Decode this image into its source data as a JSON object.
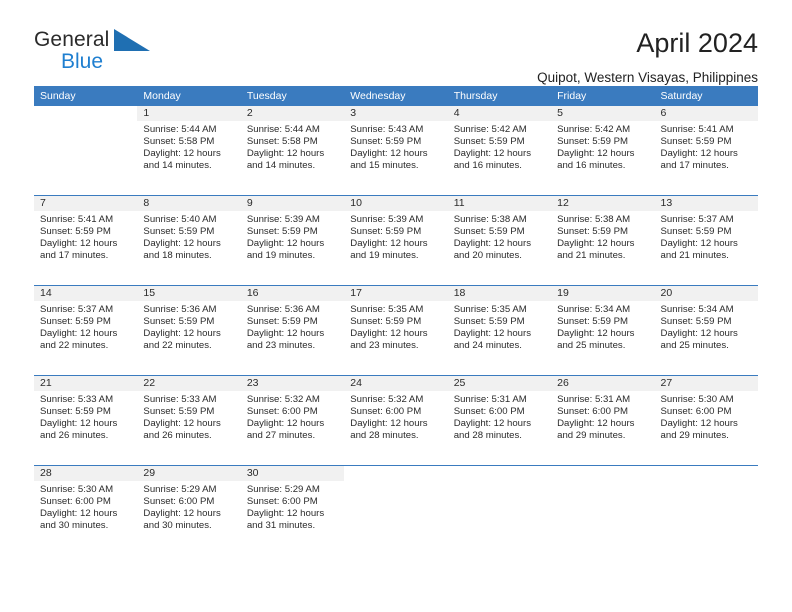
{
  "brand": {
    "name_top": "General",
    "name_bottom": "Blue",
    "triangle_icon": "blue-triangle-logo-mark",
    "color_blue": "#1f7fd0",
    "color_dark": "#2b2b2b"
  },
  "header": {
    "title": "April 2024",
    "subtitle": "Quipot, Western Visayas, Philippines"
  },
  "theme": {
    "header_bar": "#3a7bbf",
    "day_band": "#f1f1f1",
    "text": "#2b2b2b"
  },
  "calendar": {
    "weekday_headers": [
      "Sunday",
      "Monday",
      "Tuesday",
      "Wednesday",
      "Thursday",
      "Friday",
      "Saturday"
    ],
    "labels": {
      "sunrise_prefix": "Sunrise:",
      "sunset_prefix": "Sunset:",
      "daylight_prefix": "Daylight:"
    },
    "weeks": [
      [
        {
          "day": "",
          "blank": true,
          "lines": []
        },
        {
          "day": "1",
          "lines": [
            "Sunrise: 5:44 AM",
            "Sunset: 5:58 PM",
            "Daylight: 12 hours",
            "and 14 minutes."
          ]
        },
        {
          "day": "2",
          "lines": [
            "Sunrise: 5:44 AM",
            "Sunset: 5:58 PM",
            "Daylight: 12 hours",
            "and 14 minutes."
          ]
        },
        {
          "day": "3",
          "lines": [
            "Sunrise: 5:43 AM",
            "Sunset: 5:59 PM",
            "Daylight: 12 hours",
            "and 15 minutes."
          ]
        },
        {
          "day": "4",
          "lines": [
            "Sunrise: 5:42 AM",
            "Sunset: 5:59 PM",
            "Daylight: 12 hours",
            "and 16 minutes."
          ]
        },
        {
          "day": "5",
          "lines": [
            "Sunrise: 5:42 AM",
            "Sunset: 5:59 PM",
            "Daylight: 12 hours",
            "and 16 minutes."
          ]
        },
        {
          "day": "6",
          "lines": [
            "Sunrise: 5:41 AM",
            "Sunset: 5:59 PM",
            "Daylight: 12 hours",
            "and 17 minutes."
          ]
        }
      ],
      [
        {
          "day": "7",
          "lines": [
            "Sunrise: 5:41 AM",
            "Sunset: 5:59 PM",
            "Daylight: 12 hours",
            "and 17 minutes."
          ]
        },
        {
          "day": "8",
          "lines": [
            "Sunrise: 5:40 AM",
            "Sunset: 5:59 PM",
            "Daylight: 12 hours",
            "and 18 minutes."
          ]
        },
        {
          "day": "9",
          "lines": [
            "Sunrise: 5:39 AM",
            "Sunset: 5:59 PM",
            "Daylight: 12 hours",
            "and 19 minutes."
          ]
        },
        {
          "day": "10",
          "lines": [
            "Sunrise: 5:39 AM",
            "Sunset: 5:59 PM",
            "Daylight: 12 hours",
            "and 19 minutes."
          ]
        },
        {
          "day": "11",
          "lines": [
            "Sunrise: 5:38 AM",
            "Sunset: 5:59 PM",
            "Daylight: 12 hours",
            "and 20 minutes."
          ]
        },
        {
          "day": "12",
          "lines": [
            "Sunrise: 5:38 AM",
            "Sunset: 5:59 PM",
            "Daylight: 12 hours",
            "and 21 minutes."
          ]
        },
        {
          "day": "13",
          "lines": [
            "Sunrise: 5:37 AM",
            "Sunset: 5:59 PM",
            "Daylight: 12 hours",
            "and 21 minutes."
          ]
        }
      ],
      [
        {
          "day": "14",
          "lines": [
            "Sunrise: 5:37 AM",
            "Sunset: 5:59 PM",
            "Daylight: 12 hours",
            "and 22 minutes."
          ]
        },
        {
          "day": "15",
          "lines": [
            "Sunrise: 5:36 AM",
            "Sunset: 5:59 PM",
            "Daylight: 12 hours",
            "and 22 minutes."
          ]
        },
        {
          "day": "16",
          "lines": [
            "Sunrise: 5:36 AM",
            "Sunset: 5:59 PM",
            "Daylight: 12 hours",
            "and 23 minutes."
          ]
        },
        {
          "day": "17",
          "lines": [
            "Sunrise: 5:35 AM",
            "Sunset: 5:59 PM",
            "Daylight: 12 hours",
            "and 23 minutes."
          ]
        },
        {
          "day": "18",
          "lines": [
            "Sunrise: 5:35 AM",
            "Sunset: 5:59 PM",
            "Daylight: 12 hours",
            "and 24 minutes."
          ]
        },
        {
          "day": "19",
          "lines": [
            "Sunrise: 5:34 AM",
            "Sunset: 5:59 PM",
            "Daylight: 12 hours",
            "and 25 minutes."
          ]
        },
        {
          "day": "20",
          "lines": [
            "Sunrise: 5:34 AM",
            "Sunset: 5:59 PM",
            "Daylight: 12 hours",
            "and 25 minutes."
          ]
        }
      ],
      [
        {
          "day": "21",
          "lines": [
            "Sunrise: 5:33 AM",
            "Sunset: 5:59 PM",
            "Daylight: 12 hours",
            "and 26 minutes."
          ]
        },
        {
          "day": "22",
          "lines": [
            "Sunrise: 5:33 AM",
            "Sunset: 5:59 PM",
            "Daylight: 12 hours",
            "and 26 minutes."
          ]
        },
        {
          "day": "23",
          "lines": [
            "Sunrise: 5:32 AM",
            "Sunset: 6:00 PM",
            "Daylight: 12 hours",
            "and 27 minutes."
          ]
        },
        {
          "day": "24",
          "lines": [
            "Sunrise: 5:32 AM",
            "Sunset: 6:00 PM",
            "Daylight: 12 hours",
            "and 28 minutes."
          ]
        },
        {
          "day": "25",
          "lines": [
            "Sunrise: 5:31 AM",
            "Sunset: 6:00 PM",
            "Daylight: 12 hours",
            "and 28 minutes."
          ]
        },
        {
          "day": "26",
          "lines": [
            "Sunrise: 5:31 AM",
            "Sunset: 6:00 PM",
            "Daylight: 12 hours",
            "and 29 minutes."
          ]
        },
        {
          "day": "27",
          "lines": [
            "Sunrise: 5:30 AM",
            "Sunset: 6:00 PM",
            "Daylight: 12 hours",
            "and 29 minutes."
          ]
        }
      ],
      [
        {
          "day": "28",
          "lines": [
            "Sunrise: 5:30 AM",
            "Sunset: 6:00 PM",
            "Daylight: 12 hours",
            "and 30 minutes."
          ]
        },
        {
          "day": "29",
          "lines": [
            "Sunrise: 5:29 AM",
            "Sunset: 6:00 PM",
            "Daylight: 12 hours",
            "and 30 minutes."
          ]
        },
        {
          "day": "30",
          "lines": [
            "Sunrise: 5:29 AM",
            "Sunset: 6:00 PM",
            "Daylight: 12 hours",
            "and 31 minutes."
          ]
        },
        {
          "day": "",
          "blank": true,
          "lines": []
        },
        {
          "day": "",
          "blank": true,
          "lines": []
        },
        {
          "day": "",
          "blank": true,
          "lines": []
        },
        {
          "day": "",
          "blank": true,
          "lines": []
        }
      ]
    ]
  }
}
